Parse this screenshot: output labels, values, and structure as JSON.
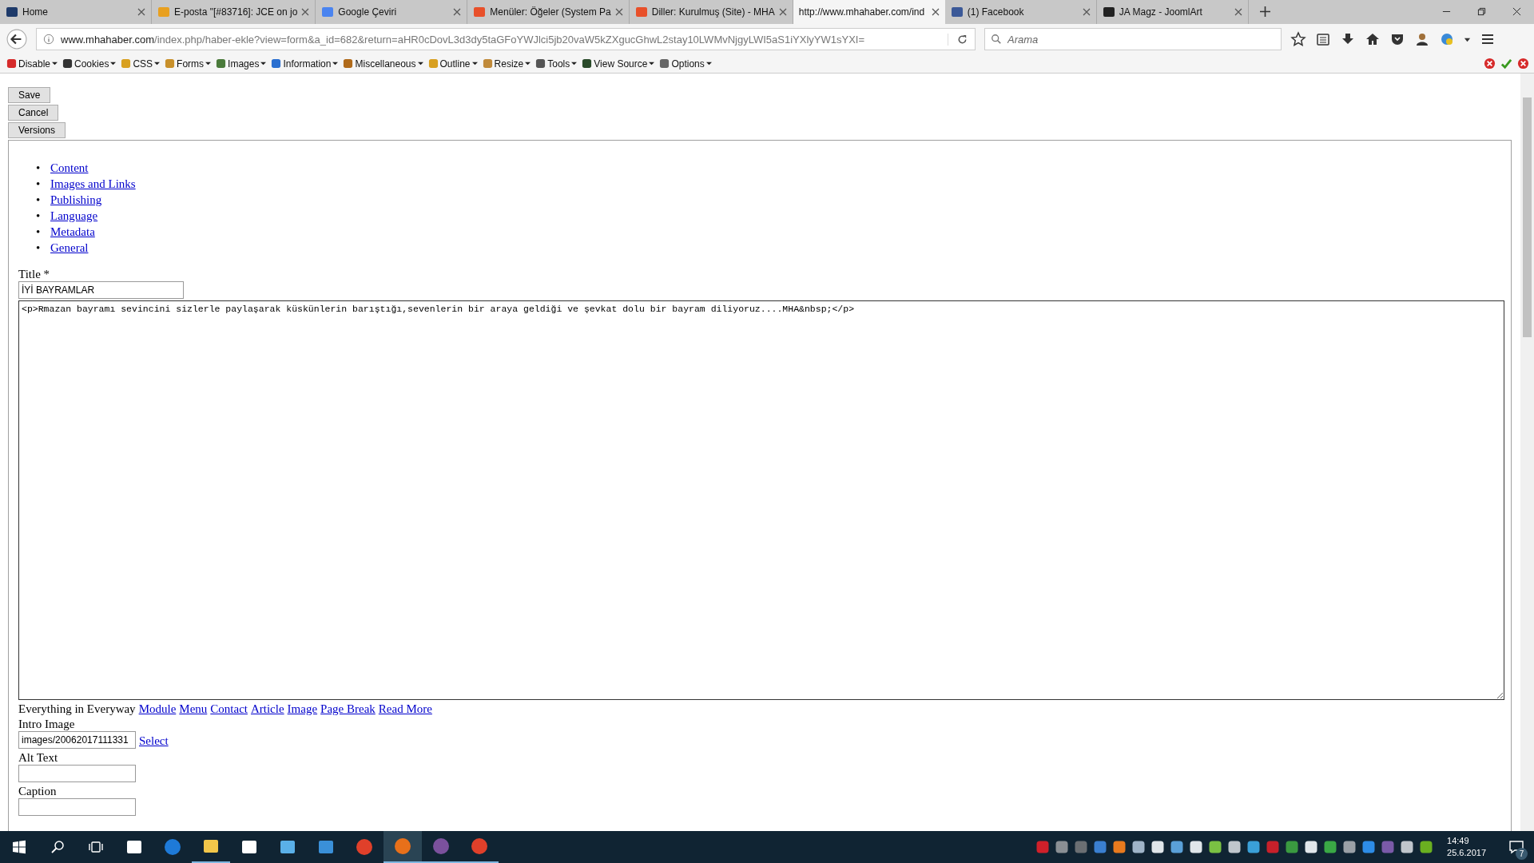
{
  "tabs": [
    {
      "title": "Home",
      "kind": "quill",
      "selected": false
    },
    {
      "title": "E-posta \"[#83716]: JCE on jo",
      "kind": "mail",
      "selected": false
    },
    {
      "title": "Google Çeviri",
      "kind": "translate",
      "selected": false
    },
    {
      "title": "Menüler: Öğeler (System Pa",
      "kind": "joomla",
      "selected": false
    },
    {
      "title": "Diller: Kurulmuş (Site) - MHA",
      "kind": "joomla",
      "selected": false
    },
    {
      "title": "http://www.mhahaber.com/ind",
      "kind": "plain",
      "selected": true
    },
    {
      "title": "(1) Facebook",
      "kind": "facebook",
      "selected": false
    },
    {
      "title": "JA Magz - JoomlArt",
      "kind": "ja",
      "selected": false
    }
  ],
  "address": {
    "host": "www.mhahaber.com",
    "path": "/index.php/haber-ekle?view=form&a_id=682&return=aHR0cDovL3d3dy5taGFoYWJlci5jb20vaW5kZXgucGhwL2stay10LWMvNjgyLWI5aS1iYXlyYW1sYXI="
  },
  "search": {
    "placeholder": "Arama"
  },
  "dev_toolbar": [
    {
      "label": "Disable",
      "kind": "disable"
    },
    {
      "label": "Cookies",
      "kind": "cookies"
    },
    {
      "label": "CSS",
      "kind": "css"
    },
    {
      "label": "Forms",
      "kind": "forms"
    },
    {
      "label": "Images",
      "kind": "images"
    },
    {
      "label": "Information",
      "kind": "information"
    },
    {
      "label": "Miscellaneous",
      "kind": "misc"
    },
    {
      "label": "Outline",
      "kind": "outline"
    },
    {
      "label": "Resize",
      "kind": "resize"
    },
    {
      "label": "Tools",
      "kind": "tools"
    },
    {
      "label": "View Source",
      "kind": "source"
    },
    {
      "label": "Options",
      "kind": "options"
    }
  ],
  "form": {
    "buttons": [
      "Save",
      "Cancel",
      "Versions"
    ],
    "section_links": [
      {
        "marker": "•",
        "label": "Content"
      },
      {
        "marker": "•",
        "label": "Images and Links"
      },
      {
        "marker": "•",
        "label": "Publishing"
      },
      {
        "marker": "•",
        "label": "Language"
      },
      {
        "marker": "•",
        "label": "Metadata"
      },
      {
        "marker": "•",
        "label": "General"
      }
    ],
    "title_label": "Title *",
    "title_value": "İYİ BAYRAMLAR",
    "body": "<p>Rmazan bayramı sevincini sizlerle paylaşarak küskünlerin barıştığı,sevenlerin bir araya geldiği ve şevkat dolu bir bayram diliyoruz....MHA&nbsp;</p>",
    "editor_label": "Everything in Everyway",
    "editor_links": [
      "Module",
      "Menu",
      "Contact",
      "Article",
      "Image",
      "Page Break",
      "Read More"
    ],
    "intro_image_label": "Intro Image",
    "intro_image_value": "images/20062017111331",
    "select_link": "Select",
    "alt_text_label": "Alt Text",
    "caption_label": "Caption"
  },
  "taskbar": {
    "apps": [
      {
        "kind": "calendar",
        "running": false,
        "selected": false
      },
      {
        "kind": "edge",
        "running": false,
        "selected": false
      },
      {
        "kind": "explorer",
        "running": true,
        "selected": false
      },
      {
        "kind": "store",
        "running": false,
        "selected": false
      },
      {
        "kind": "remote",
        "running": false,
        "selected": false
      },
      {
        "kind": "contacts",
        "running": false,
        "selected": false
      },
      {
        "kind": "chrome",
        "running": false,
        "selected": false
      },
      {
        "kind": "firefox",
        "running": true,
        "selected": true
      },
      {
        "kind": "viber",
        "running": true,
        "selected": false
      },
      {
        "kind": "chrome",
        "running": true,
        "selected": false
      }
    ],
    "time": "14:49",
    "date": "25.6.2017",
    "notifications": "7"
  }
}
